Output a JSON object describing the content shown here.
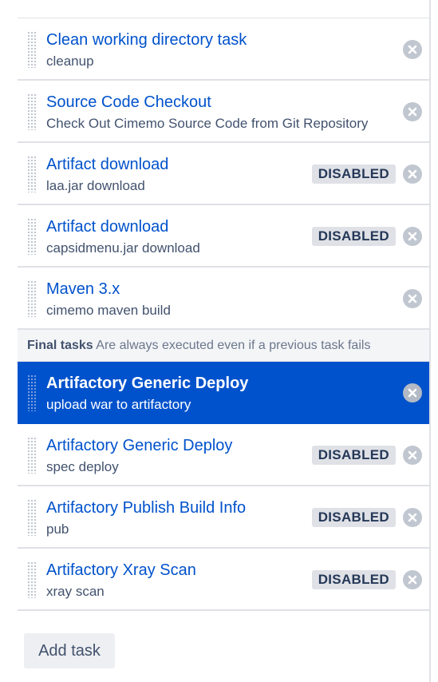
{
  "tasks": [
    {
      "title": "Clean working directory task",
      "description": "cleanup",
      "badge": ""
    },
    {
      "title": "Source Code Checkout",
      "description": "Check Out Cimemo Source Code from Git Repository",
      "badge": ""
    },
    {
      "title": "Artifact download",
      "description": "laa.jar download",
      "badge": "DISABLED"
    },
    {
      "title": "Artifact download",
      "description": "capsidmenu.jar download",
      "badge": "DISABLED"
    },
    {
      "title": "Maven 3.x",
      "description": "cimemo maven build",
      "badge": ""
    }
  ],
  "final_section": {
    "label": "Final tasks",
    "note": "Are always executed even if a previous task fails"
  },
  "final_tasks": [
    {
      "title": "Artifactory Generic Deploy",
      "description": "upload war to artifactory",
      "badge": "",
      "selected": true
    },
    {
      "title": "Artifactory Generic Deploy",
      "description": "spec deploy",
      "badge": "DISABLED"
    },
    {
      "title": "Artifactory Publish Build Info",
      "description": "pub",
      "badge": "DISABLED"
    },
    {
      "title": "Artifactory Xray Scan",
      "description": "xray scan",
      "badge": "DISABLED"
    }
  ],
  "add_task_label": "Add task",
  "colors": {
    "link": "#0052cc",
    "selected_bg": "#0052cc",
    "badge_bg": "#dfe1e6",
    "remove_icon_bg": "#c1c7d0"
  },
  "icons": {
    "drag": "drag-handle-icon",
    "remove": "close-circle-icon"
  }
}
